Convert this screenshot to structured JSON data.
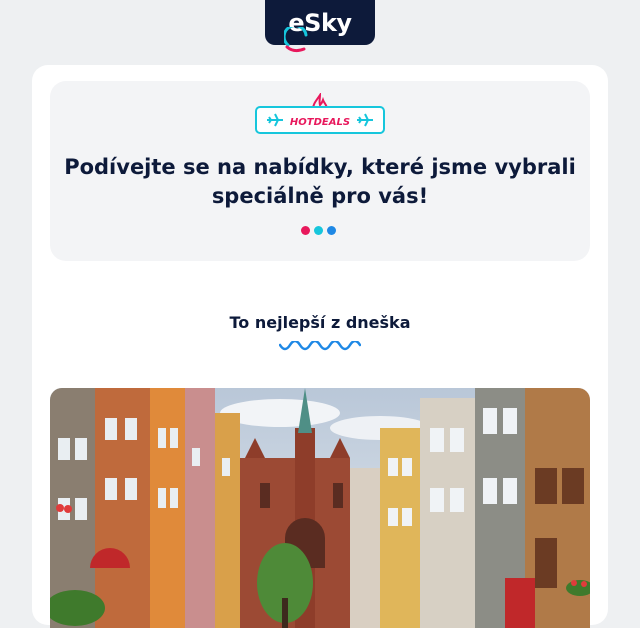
{
  "brand": {
    "logo_text": "eSky",
    "logo_bg": "#0d1a3a",
    "accent_pink": "#e8185c",
    "accent_cyan": "#16c6dc"
  },
  "hero": {
    "badge_text": "HOTDEALS",
    "title": "Podívejte se na nabídky, které jsme vybrali\nspeciálně pro vás!",
    "dots_colors": [
      "#e8185c",
      "#16c6dc",
      "#1e88e5"
    ]
  },
  "section": {
    "title": "To nejlepší z dneška"
  },
  "deal_image": {
    "subject": "old-town-street-with-colorful-houses-and-church"
  }
}
